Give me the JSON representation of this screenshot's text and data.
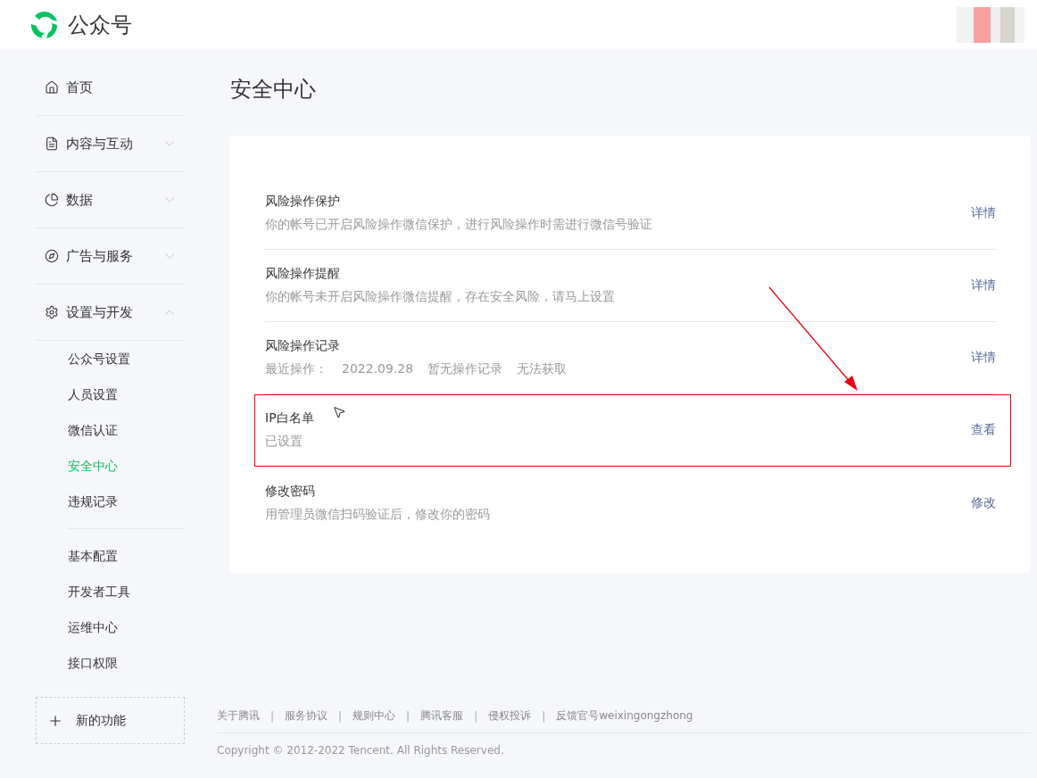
{
  "header": {
    "logo_text": "公众号"
  },
  "sidebar": {
    "items": [
      {
        "label": "首页"
      },
      {
        "label": "内容与互动",
        "expanded": false
      },
      {
        "label": "数据",
        "expanded": false
      },
      {
        "label": "广告与服务",
        "expanded": false
      },
      {
        "label": "设置与开发",
        "expanded": true,
        "groups": [
          {
            "items": [
              {
                "label": "公众号设置",
                "selected": false
              },
              {
                "label": "人员设置",
                "selected": false
              },
              {
                "label": "微信认证",
                "selected": false
              },
              {
                "label": "安全中心",
                "selected": true
              },
              {
                "label": "违规记录",
                "selected": false
              }
            ]
          },
          {
            "items": [
              {
                "label": "基本配置",
                "selected": false
              },
              {
                "label": "开发者工具",
                "selected": false
              },
              {
                "label": "运维中心",
                "selected": false
              },
              {
                "label": "接口权限",
                "selected": false
              }
            ]
          }
        ]
      }
    ],
    "new_feature": "新的功能"
  },
  "page_title": "安全中心",
  "rows": [
    {
      "title": "风险操作保护",
      "parts": [
        "你的帐号已开启风险操作微信保护，进行风险操作时需进行微信号验证"
      ],
      "action": "详情",
      "highlighted": false
    },
    {
      "title": "风险操作提醒",
      "parts": [
        "你的帐号未开启风险操作微信提醒，存在安全风险，请马上设置"
      ],
      "action": "详情",
      "highlighted": false
    },
    {
      "title": "风险操作记录",
      "parts": [
        "最近操作：",
        "2022.09.28",
        "暂无操作记录",
        "无法获取"
      ],
      "action": "详情",
      "highlighted": false
    },
    {
      "title": "IP白名单",
      "parts": [
        "已设置"
      ],
      "action": "查看",
      "highlighted": true
    },
    {
      "title": "修改密码",
      "parts": [
        "用管理员微信扫码验证后，修改你的密码"
      ],
      "action": "修改",
      "highlighted": false
    }
  ],
  "annotation_arrow": true,
  "footer": {
    "items": [
      {
        "kind": "link",
        "text": "关于腾讯"
      },
      {
        "kind": "separator",
        "text": "|"
      },
      {
        "kind": "link",
        "text": "服务协议"
      },
      {
        "kind": "separator",
        "text": "|"
      },
      {
        "kind": "link",
        "text": "规则中心"
      },
      {
        "kind": "separator",
        "text": "|"
      },
      {
        "kind": "link",
        "text": "腾讯客服"
      },
      {
        "kind": "separator",
        "text": "|"
      },
      {
        "kind": "link",
        "text": "侵权投诉"
      },
      {
        "kind": "separator",
        "text": "|"
      },
      {
        "kind": "link",
        "text": "反馈官号weixingongzhong"
      }
    ],
    "copyright": "Copyright © 2012-2022 Tencent. All Rights Reserved."
  }
}
